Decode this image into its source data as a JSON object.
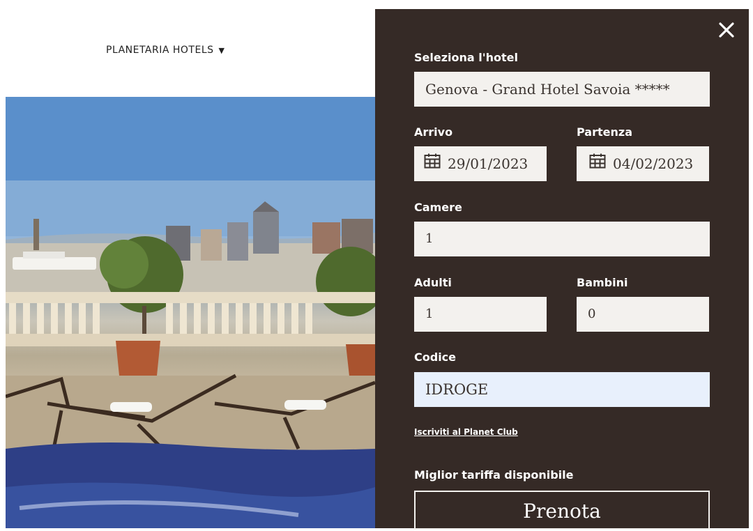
{
  "header": {
    "brand": "PLANETARIA HOTELS",
    "caret": "▼"
  },
  "booking": {
    "hotel": {
      "label": "Seleziona l'hotel",
      "value": "Genova - Grand Hotel Savoia *****"
    },
    "arrival": {
      "label": "Arrivo",
      "value": "29/01/2023"
    },
    "departure": {
      "label": "Partenza",
      "value": "04/02/2023"
    },
    "rooms": {
      "label": "Camere",
      "value": "1"
    },
    "adults": {
      "label": "Adulti",
      "value": "1"
    },
    "children": {
      "label": "Bambini",
      "value": "0"
    },
    "code": {
      "label": "Codice",
      "value": "IDROGE"
    },
    "club_link": "Iscriviti al Planet Club",
    "best_rate": "Miglior tariffa disponibile",
    "book_button": "Prenota"
  },
  "icons": {
    "close": "close-icon",
    "calendar": "calendar-icon"
  },
  "colors": {
    "panel_bg": "#352a26",
    "field_bg": "#f3f1ee",
    "code_field_bg": "#e8f0fc"
  }
}
